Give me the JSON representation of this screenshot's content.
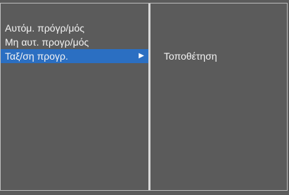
{
  "menu": {
    "items": [
      {
        "label": "Αυτόμ. πρόγρ/μός"
      },
      {
        "label": "Μη αυτ. προγρ/μός"
      },
      {
        "label": "Ταξ/ση προγρ.",
        "selected": true
      }
    ]
  },
  "submenu": {
    "option_label": "Τοποθέτηση"
  },
  "icons": {
    "selected_arrow": "play-right-icon"
  },
  "colors": {
    "background": "#5b5b5b",
    "highlight": "#2b6fc2",
    "text": "#f4f4f4"
  }
}
